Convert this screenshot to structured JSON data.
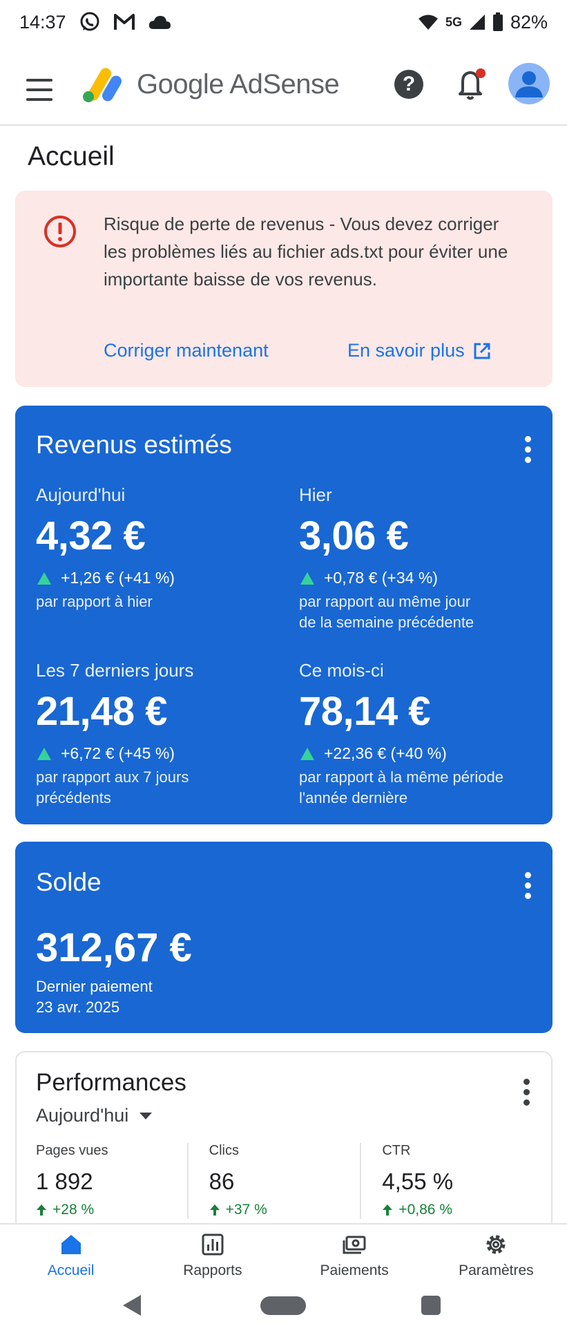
{
  "status_bar": {
    "time": "14:37",
    "network": "5G",
    "battery": "82%",
    "icons": [
      "whatsapp-icon",
      "gmail-icon",
      "cloud-icon",
      "wifi-icon",
      "signal-icon",
      "battery-icon"
    ]
  },
  "app_bar": {
    "logo_text": "Google AdSense",
    "has_notification_dot": true
  },
  "page_title": "Accueil",
  "alert": {
    "message": "Risque de perte de revenus - Vous devez corriger les problèmes liés au fichier ads.txt pour éviter une importante baisse de vos revenus.",
    "fix_label": "Corriger maintenant",
    "learn_more_label": "En savoir plus"
  },
  "revenue": {
    "title": "Revenus estimés",
    "today": {
      "label": "Aujourd'hui",
      "value": "4,32 €",
      "delta": "+1,26 € (+41 %)",
      "comparison": "par rapport à hier"
    },
    "yesterday": {
      "label": "Hier",
      "value": "3,06 €",
      "delta": "+0,78 € (+34 %)",
      "comparison_line1": "par rapport au même jour",
      "comparison_line2": "de la semaine précédente"
    },
    "last7": {
      "label": "Les 7 derniers jours",
      "value": "21,48 €",
      "delta": "+6,72 € (+45 %)",
      "comparison_line1": "par rapport aux 7 jours",
      "comparison_line2": "précédents"
    },
    "month": {
      "label": "Ce mois-ci",
      "value": "78,14 €",
      "delta": "+22,36 € (+40 %)",
      "comparison_line1": "par rapport à la même période",
      "comparison_line2": "l'année dernière"
    }
  },
  "balance": {
    "title": "Solde",
    "value": "312,67 €",
    "last_payment_label": "Dernier paiement",
    "last_payment_date": "23 avr. 2025"
  },
  "performance": {
    "title": "Performances",
    "period": "Aujourd'hui",
    "metrics": [
      {
        "label": "Pages vues",
        "value": "1 892",
        "delta": "+28 %"
      },
      {
        "label": "Clics",
        "value": "86",
        "delta": "+37 %"
      },
      {
        "label": "CTR",
        "value": "4,55 %",
        "delta": "+0,86 %"
      }
    ]
  },
  "bottom_nav": {
    "items": [
      {
        "label": "Accueil",
        "icon": "home-icon",
        "active": true
      },
      {
        "label": "Rapports",
        "icon": "reports-icon",
        "active": false
      },
      {
        "label": "Paiements",
        "icon": "payments-icon",
        "active": false
      },
      {
        "label": "Paramètres",
        "icon": "settings-icon",
        "active": false
      }
    ]
  },
  "colors": {
    "accent": "#1a73e8",
    "card_blue": "#1967d2",
    "alert_bg": "#fce8e6",
    "alert_red": "#d93025",
    "positive": "#34d399"
  }
}
